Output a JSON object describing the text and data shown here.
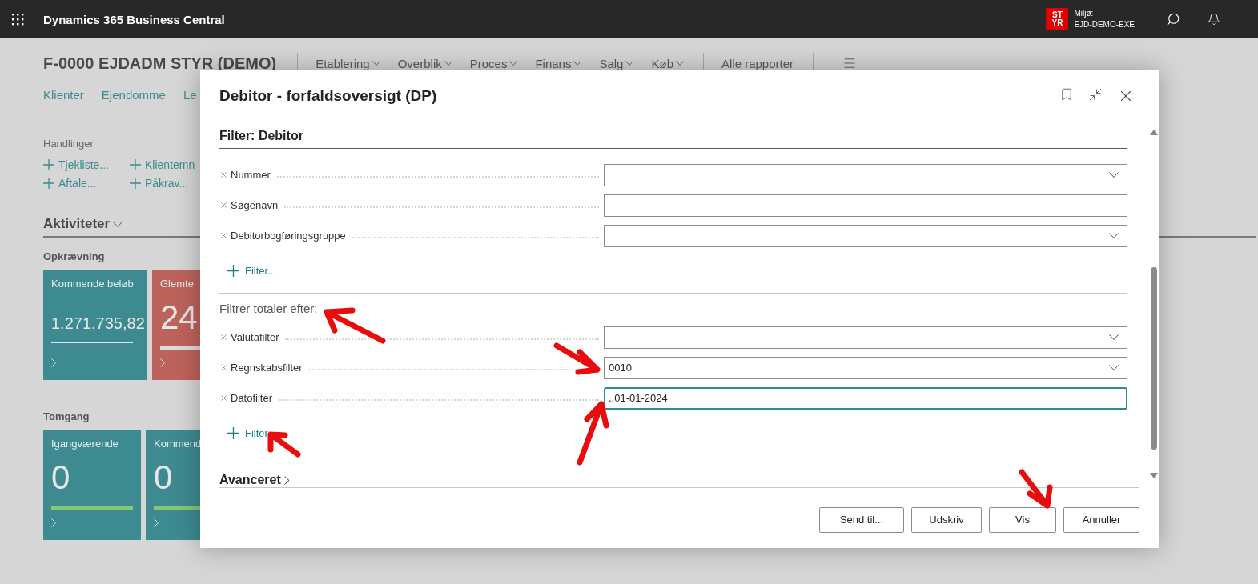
{
  "top_bar": {
    "app_name": "Dynamics 365 Business Central",
    "environment_badge": [
      "ST",
      "YR"
    ],
    "environment_label": "Miljø:",
    "environment_name": "EJD-DEMO-EXE"
  },
  "page": {
    "title": "F-0000 EJDADM STYR (DEMO)",
    "menu": [
      "Etablering",
      "Overblik",
      "Proces",
      "Finans",
      "Salg",
      "Køb"
    ],
    "reports_link": "Alle rapporter",
    "nav_links": [
      "Klienter",
      "Ejendomme",
      "Le"
    ],
    "actions_label": "Handlinger",
    "actions": [
      "Tjekliste...",
      "Klientemn",
      "Aftale...",
      "Påkrav..."
    ],
    "activities_heading": "Aktiviteter",
    "groups": [
      {
        "title": "Opkrævning",
        "tiles": [
          {
            "title": "Kommende beløb",
            "value": "1.271.735,82",
            "color": "#3e8a91",
            "indicator": {
              "kind": "thin",
              "color": "#e8e8e8"
            }
          },
          {
            "title": "Glemte",
            "value": "24",
            "color": "#bd635c",
            "indicator": {
              "kind": "thick",
              "color": "#dcdcdc"
            }
          }
        ]
      },
      {
        "title": "Tomgang",
        "tiles": [
          {
            "title": "Igangværende",
            "value": "0",
            "color": "#3e8a91",
            "indicator": {
              "kind": "thick",
              "color": "#86c777"
            }
          },
          {
            "title": "Kommend",
            "value": "0",
            "color": "#3e8a91",
            "indicator": {
              "kind": "thick",
              "color": "#86c777"
            }
          }
        ]
      }
    ]
  },
  "dialog": {
    "title": "Debitor - forfaldsoversigt (DP)",
    "sections": [
      {
        "title": "Filter: Debitor",
        "kind": "heading",
        "add_filter": "Filter...",
        "fields": [
          {
            "label": "Nummer",
            "kind": "dropdown",
            "focused": false
          },
          {
            "label": "Søgenavn",
            "kind": "text",
            "focused": false
          },
          {
            "label": "Debitorbogføringsgruppe",
            "kind": "dropdown",
            "focused": false
          }
        ]
      },
      {
        "title": "Filtrer totaler efter:",
        "kind": "subheading",
        "add_filter": "Filter",
        "fields": [
          {
            "label": "Valutafilter",
            "kind": "dropdown",
            "focused": false
          },
          {
            "label": "Regnskabsfilter",
            "kind": "dropdown",
            "value": "0010",
            "focused": false
          },
          {
            "label": "Datofilter",
            "kind": "text",
            "value": "..01-01-2024",
            "focused": true
          }
        ]
      }
    ],
    "advanced": "Avanceret",
    "buttons": [
      "Send til...",
      "Udskriv",
      "Vis",
      "Annuller"
    ]
  }
}
